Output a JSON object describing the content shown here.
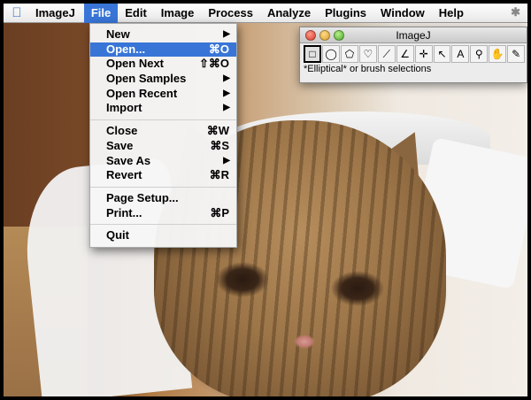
{
  "menubar": {
    "apple_icon": "apple-icon",
    "app_name": "ImageJ",
    "menus": [
      "File",
      "Edit",
      "Image",
      "Process",
      "Analyze",
      "Plugins",
      "Window",
      "Help"
    ],
    "active_menu": "File",
    "status_icon": "bluetooth-icon"
  },
  "file_menu": {
    "items": [
      {
        "label": "New",
        "shortcut": "",
        "submenu": true
      },
      {
        "label": "Open...",
        "shortcut": "⌘O",
        "submenu": false,
        "selected": true
      },
      {
        "label": "Open Next",
        "shortcut": "⇧⌘O",
        "submenu": false
      },
      {
        "label": "Open Samples",
        "shortcut": "",
        "submenu": true
      },
      {
        "label": "Open Recent",
        "shortcut": "",
        "submenu": true
      },
      {
        "label": "Import",
        "shortcut": "",
        "submenu": true
      },
      {
        "label": "Close",
        "shortcut": "⌘W",
        "submenu": false
      },
      {
        "label": "Save",
        "shortcut": "⌘S",
        "submenu": false
      },
      {
        "label": "Save As",
        "shortcut": "",
        "submenu": true
      },
      {
        "label": "Revert",
        "shortcut": "⌘R",
        "submenu": false
      },
      {
        "label": "Page Setup...",
        "shortcut": "",
        "submenu": false
      },
      {
        "label": "Print...",
        "shortcut": "⌘P",
        "submenu": false
      },
      {
        "label": "Quit",
        "shortcut": "",
        "submenu": false
      }
    ],
    "submenu_arrow": "▶"
  },
  "imagej_window": {
    "title": "ImageJ",
    "status_text": "*Elliptical* or brush selections",
    "tools": [
      {
        "name": "rectangle-tool-icon",
        "glyph": "□",
        "active": true
      },
      {
        "name": "oval-tool-icon",
        "glyph": "◯"
      },
      {
        "name": "polygon-tool-icon",
        "glyph": "⬠"
      },
      {
        "name": "freehand-tool-icon",
        "glyph": "♡"
      },
      {
        "name": "line-tool-icon",
        "glyph": "⟋"
      },
      {
        "name": "angle-tool-icon",
        "glyph": "∠"
      },
      {
        "name": "point-tool-icon",
        "glyph": "✛"
      },
      {
        "name": "wand-tool-icon",
        "glyph": "↖"
      },
      {
        "name": "text-tool-icon",
        "glyph": "A"
      },
      {
        "name": "magnifier-tool-icon",
        "glyph": "⚲"
      },
      {
        "name": "scroll-tool-icon",
        "glyph": "✋"
      },
      {
        "name": "dropper-tool-icon",
        "glyph": "✎"
      },
      {
        "name": "more-tools-icon",
        "glyph": "»"
      }
    ]
  }
}
